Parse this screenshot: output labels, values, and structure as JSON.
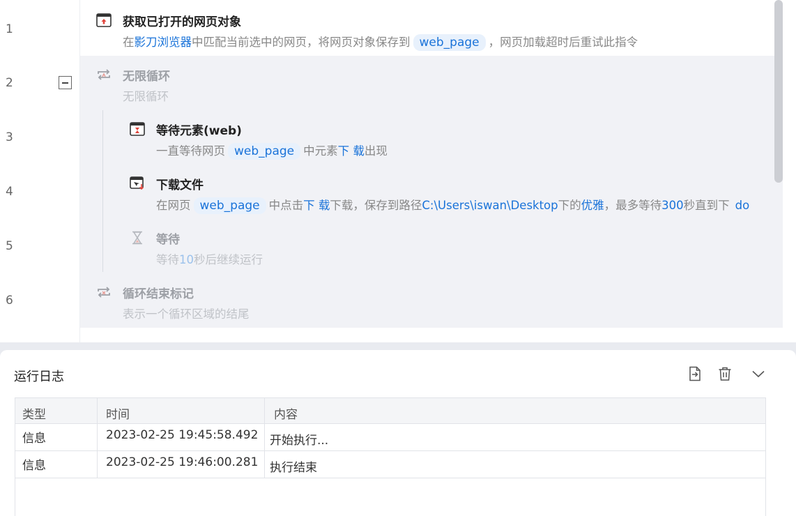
{
  "line_numbers": [
    "1",
    "2",
    "3",
    "4",
    "5",
    "6"
  ],
  "steps": [
    {
      "title": "获取已打开的网页对象",
      "desc_parts": [
        "在",
        "影刀浏览器",
        "中匹配当前选中的网页，将网页对象保存到",
        "web_page",
        "，网页加载超时后重试此指令"
      ]
    },
    {
      "title": "无限循环",
      "desc": "无限循环"
    },
    {
      "title": "等待元素(web)",
      "desc_parts": [
        "一直等待网页",
        "web_page",
        "中元素",
        "下 载",
        "出现"
      ]
    },
    {
      "title": "下载文件",
      "desc_parts": [
        "在网页",
        "web_page",
        "中点击",
        "下 载",
        "下载，保存到路径",
        "C:\\Users\\iswan\\Desktop",
        "下的",
        "优雅",
        "，最多等待",
        "300",
        "秒直到下",
        "do"
      ]
    },
    {
      "title": "等待",
      "desc_parts": [
        "等待",
        "10",
        "秒后继续运行"
      ]
    },
    {
      "title": "循环结束标记",
      "desc": "表示一个循环区域的结尾"
    }
  ],
  "log": {
    "title": "运行日志",
    "columns": [
      "类型",
      "时间",
      "内容"
    ],
    "rows": [
      {
        "type": "信息",
        "time": "2023-02-25 19:45:58.492",
        "content": "开始执行..."
      },
      {
        "type": "信息",
        "time": "2023-02-25 19:46:00.281",
        "content": "执行结束"
      }
    ],
    "toolbar_icons": [
      "export-icon",
      "trash-icon",
      "chevron-down-icon"
    ]
  },
  "colors": {
    "accent": "#1a73d9",
    "chip_bg": "#e8f1fc",
    "loop_bg": "#f1f2f6",
    "icon_red": "#e0433a"
  }
}
